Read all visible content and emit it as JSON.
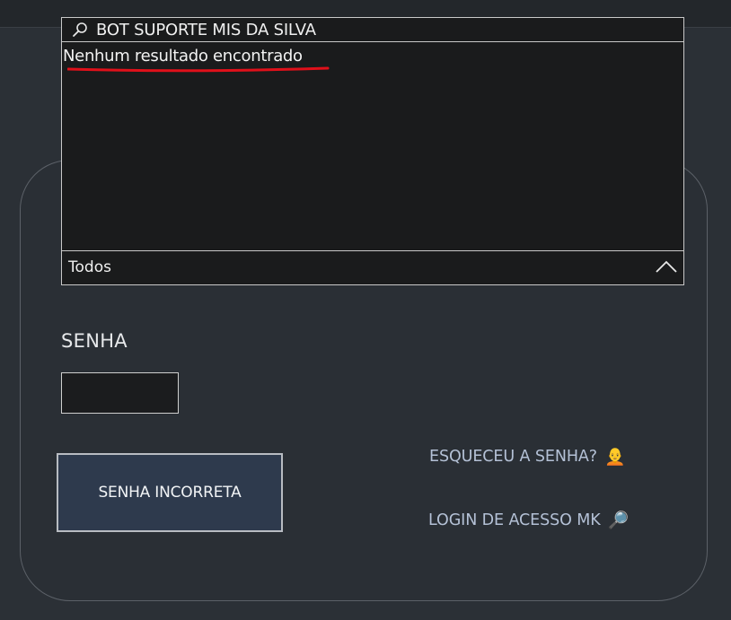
{
  "dropdown": {
    "search_value": "BOT SUPORTE MIS DA SILVA",
    "no_results": "Nenhum resultado encontrado",
    "filter_label": "Todos"
  },
  "form": {
    "password_label": "SENHA",
    "password_value": "",
    "submit_label": "SENHA INCORRETA"
  },
  "links": {
    "forgot_password": "ESQUECEU A SENHA?",
    "forgot_password_emoji": "🧑‍🦲",
    "login_access": "LOGIN DE ACESSO MK",
    "login_access_emoji": "🔎"
  },
  "colors": {
    "background": "#2b3036",
    "dropdown_bg": "#1a1b1c",
    "button_bg": "#2e3a4d",
    "link": "#b4c1d6",
    "annotation_red": "#e0101a"
  }
}
